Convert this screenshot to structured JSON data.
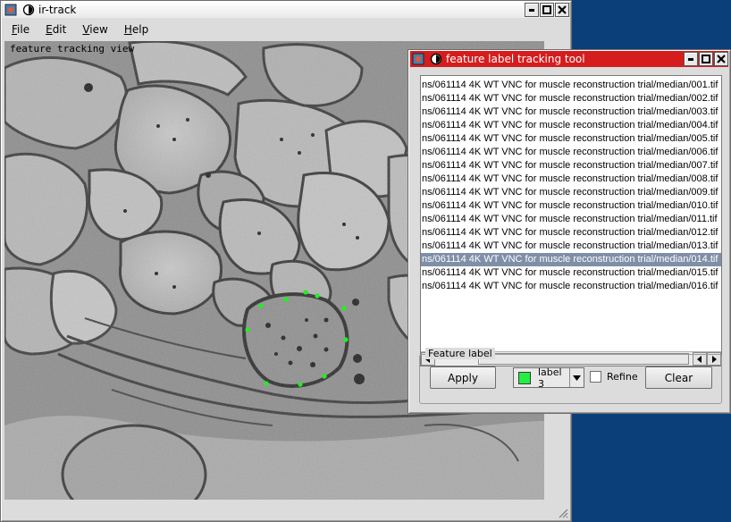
{
  "main_window": {
    "title": "ir-track",
    "menu": [
      {
        "underline": "F",
        "rest": "ile"
      },
      {
        "underline": "E",
        "rest": "dit"
      },
      {
        "underline": "V",
        "rest": "iew"
      },
      {
        "underline": "H",
        "rest": "elp"
      }
    ],
    "view_label": "feature tracking view",
    "tracked_points_color": "#22ee22"
  },
  "tool_window": {
    "title": "feature label tracking tool",
    "titlebar_color": "#d51d1d",
    "file_list": [
      {
        "text": "ns/061114 4K WT VNC for muscle reconstruction trial/median/001.tif",
        "selected": false
      },
      {
        "text": "ns/061114 4K WT VNC for muscle reconstruction trial/median/002.tif",
        "selected": false
      },
      {
        "text": "ns/061114 4K WT VNC for muscle reconstruction trial/median/003.tif",
        "selected": false
      },
      {
        "text": "ns/061114 4K WT VNC for muscle reconstruction trial/median/004.tif",
        "selected": false
      },
      {
        "text": "ns/061114 4K WT VNC for muscle reconstruction trial/median/005.tif",
        "selected": false
      },
      {
        "text": "ns/061114 4K WT VNC for muscle reconstruction trial/median/006.tif",
        "selected": false
      },
      {
        "text": "ns/061114 4K WT VNC for muscle reconstruction trial/median/007.tif",
        "selected": false
      },
      {
        "text": "ns/061114 4K WT VNC for muscle reconstruction trial/median/008.tif",
        "selected": false
      },
      {
        "text": "ns/061114 4K WT VNC for muscle reconstruction trial/median/009.tif",
        "selected": false
      },
      {
        "text": "ns/061114 4K WT VNC for muscle reconstruction trial/median/010.tif",
        "selected": false
      },
      {
        "text": "ns/061114 4K WT VNC for muscle reconstruction trial/median/011.tif",
        "selected": false
      },
      {
        "text": "ns/061114 4K WT VNC for muscle reconstruction trial/median/012.tif",
        "selected": false
      },
      {
        "text": "ns/061114 4K WT VNC for muscle reconstruction trial/median/013.tif",
        "selected": false
      },
      {
        "text": "ns/061114 4K WT VNC for muscle reconstruction trial/median/014.tif",
        "selected": true
      },
      {
        "text": "ns/061114 4K WT VNC for muscle reconstruction trial/median/015.tif",
        "selected": false
      },
      {
        "text": "ns/061114 4K WT VNC for muscle reconstruction trial/median/016.tif",
        "selected": false
      }
    ],
    "feature_label_group": "Feature label",
    "apply_label": "Apply",
    "label_select_value": "label 3",
    "label_color": "#22ee44",
    "refine_label": "Refine",
    "refine_checked": false,
    "clear_label": "Clear"
  }
}
